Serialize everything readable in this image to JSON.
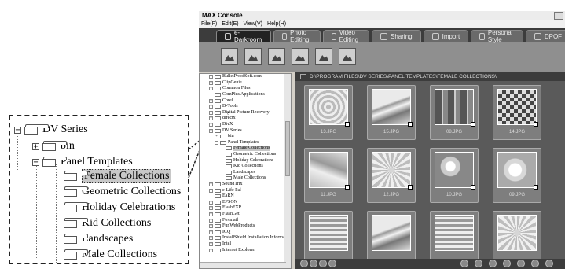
{
  "callout": {
    "items": [
      {
        "label": "DV Series",
        "expander": "−"
      },
      {
        "label": "bin",
        "expander": "+"
      },
      {
        "label": "Panel Templates",
        "expander": "−"
      },
      {
        "label": "Female Collections"
      },
      {
        "label": "Geometric Collections"
      },
      {
        "label": "Holiday Celebrations"
      },
      {
        "label": "Kid Collections"
      },
      {
        "label": "Landscapes"
      },
      {
        "label": "Male Collections"
      }
    ]
  },
  "window": {
    "title": "MAX Console",
    "menu": [
      "File(F)",
      "Edit(E)",
      "View(V)",
      "Help(H)"
    ],
    "tabs": [
      "e-Darkroom",
      "Photo Editing",
      "Video Editing",
      "Sharing",
      "Import",
      "Personal Style",
      "DPOF"
    ],
    "active_tab": "e-Darkroom",
    "toolbar_icons": [
      "picture-icon",
      "picture-icon",
      "picture-icon",
      "picture-icon",
      "picture-icon",
      "picture-icon"
    ]
  },
  "tree": {
    "items": [
      {
        "label": "BulletProofSoft.com",
        "exp": "+"
      },
      {
        "label": "ClipGenie",
        "exp": "+"
      },
      {
        "label": "Common Files",
        "exp": "+"
      },
      {
        "label": "ComPlus Applications",
        "exp": ""
      },
      {
        "label": "Corel",
        "exp": "+"
      },
      {
        "label": "D-Tools",
        "exp": "+"
      },
      {
        "label": "Digital Picture Recovery",
        "exp": "+"
      },
      {
        "label": "directx",
        "exp": "+"
      },
      {
        "label": "DivX",
        "exp": "+"
      },
      {
        "label": "DV Series",
        "exp": "−"
      },
      {
        "label": "bin",
        "exp": "+"
      },
      {
        "label": "Panel Templates",
        "exp": "−"
      },
      {
        "label": "Female Collections",
        "exp": "",
        "selected": true
      },
      {
        "label": "Geometric Collections",
        "exp": ""
      },
      {
        "label": "Holiday Celebrations",
        "exp": ""
      },
      {
        "label": "Kid Collections",
        "exp": ""
      },
      {
        "label": "Landscapes",
        "exp": ""
      },
      {
        "label": "Male Collections",
        "exp": ""
      },
      {
        "label": "SoundTrix",
        "exp": "+"
      },
      {
        "label": "e-Life Pal",
        "exp": "+"
      },
      {
        "label": "EaRN",
        "exp": ""
      },
      {
        "label": "EPSON",
        "exp": "+"
      },
      {
        "label": "FlashFXP",
        "exp": "+"
      },
      {
        "label": "FlashGet",
        "exp": "+"
      },
      {
        "label": "Foxmail",
        "exp": "+"
      },
      {
        "label": "FunWebProducts",
        "exp": "+"
      },
      {
        "label": "ICQ",
        "exp": "+"
      },
      {
        "label": "InstallShield Installation Informati",
        "exp": "+"
      },
      {
        "label": "Intel",
        "exp": "+"
      },
      {
        "label": "Internet Explorer",
        "exp": "+"
      }
    ]
  },
  "gallery": {
    "path": "D:\\PROGRAM FILES\\DV SERIES\\PANEL TEMPLATES\\FEMALE COLLECTIONS\\",
    "thumbnails": [
      "13.JPG",
      "15.JPG",
      "08.JPG",
      "14.JPG",
      "11.JPG",
      "12.JPG",
      "10.JPG",
      "09.JPG",
      "",
      "",
      "",
      ""
    ]
  }
}
